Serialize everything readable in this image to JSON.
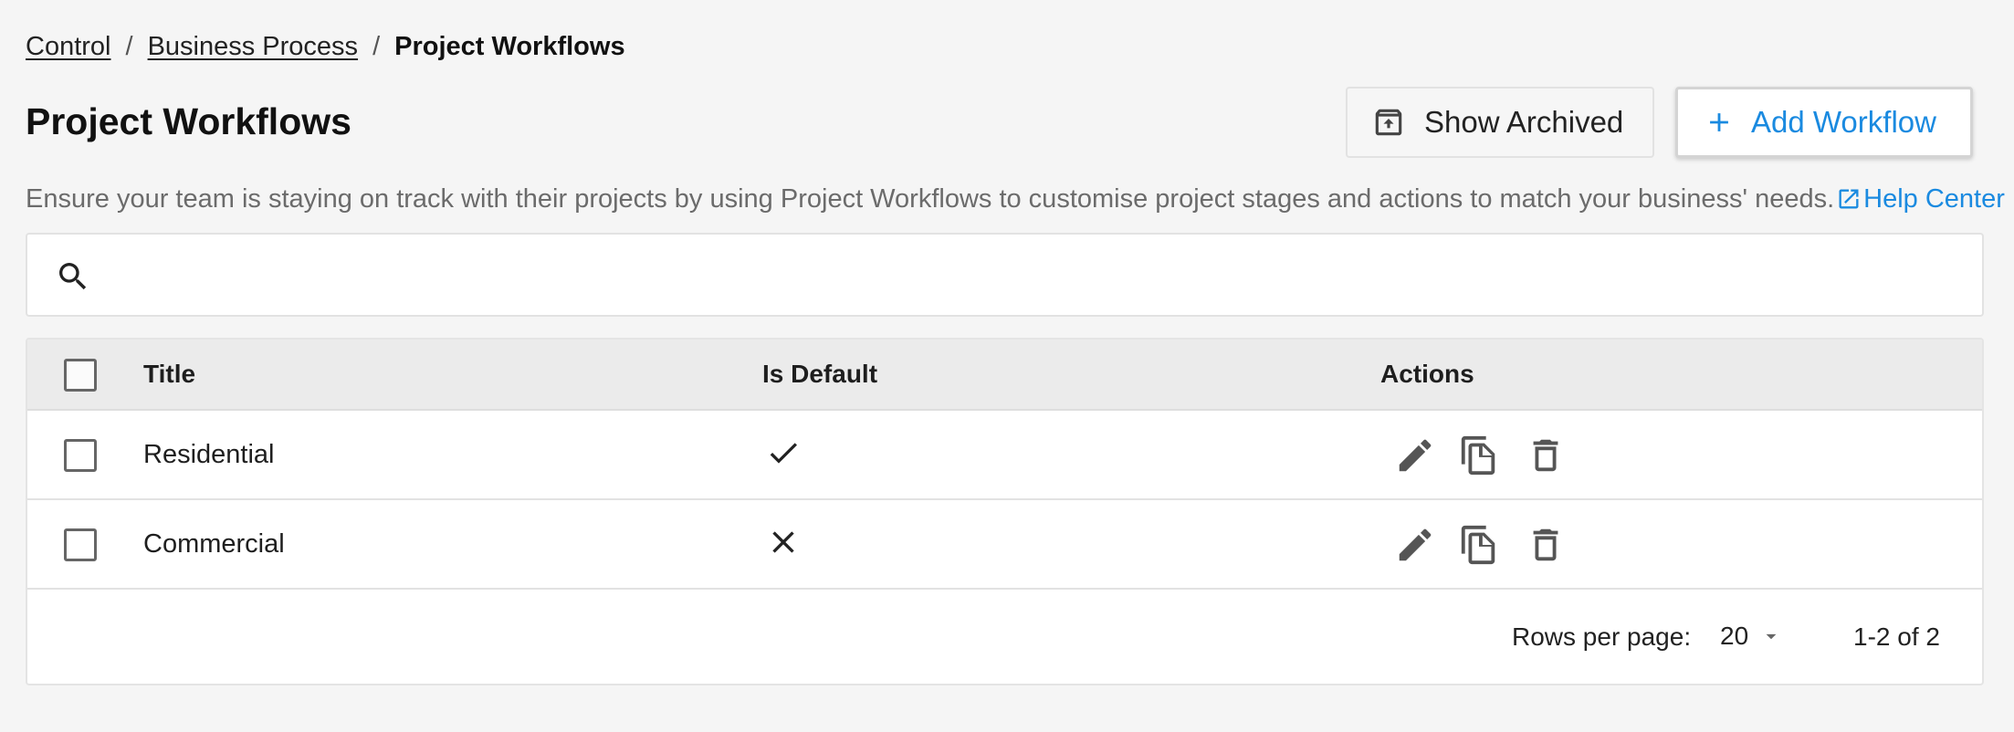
{
  "breadcrumb": {
    "items": [
      "Control",
      "Business Process"
    ],
    "separator": "/",
    "current": "Project Workflows"
  },
  "header": {
    "title": "Project Workflows",
    "show_archived_label": "Show Archived",
    "add_workflow_label": "Add Workflow"
  },
  "description": {
    "text": "Ensure your team is staying on track with their projects by using Project Workflows to customise project stages and actions to match your business' needs.",
    "help_link": "Help Center"
  },
  "search": {
    "value": "",
    "placeholder": "",
    "icon": "search-icon"
  },
  "table": {
    "columns": [
      "Title",
      "Is Default",
      "Actions"
    ],
    "rows": [
      {
        "title": "Residential",
        "is_default": "check-icon"
      },
      {
        "title": "Commercial",
        "is_default": "close-icon"
      }
    ],
    "action_icons": [
      "edit-icon",
      "copy-icon",
      "delete-icon"
    ]
  },
  "pagination": {
    "rows_per_page_label": "Rows per page:",
    "rows_per_page_value": "20",
    "range": "1-2 of 2"
  },
  "colors": {
    "accent": "#1a8ae0",
    "background": "#f5f5f5",
    "header_row": "#ebebeb",
    "icon": "#555555"
  }
}
